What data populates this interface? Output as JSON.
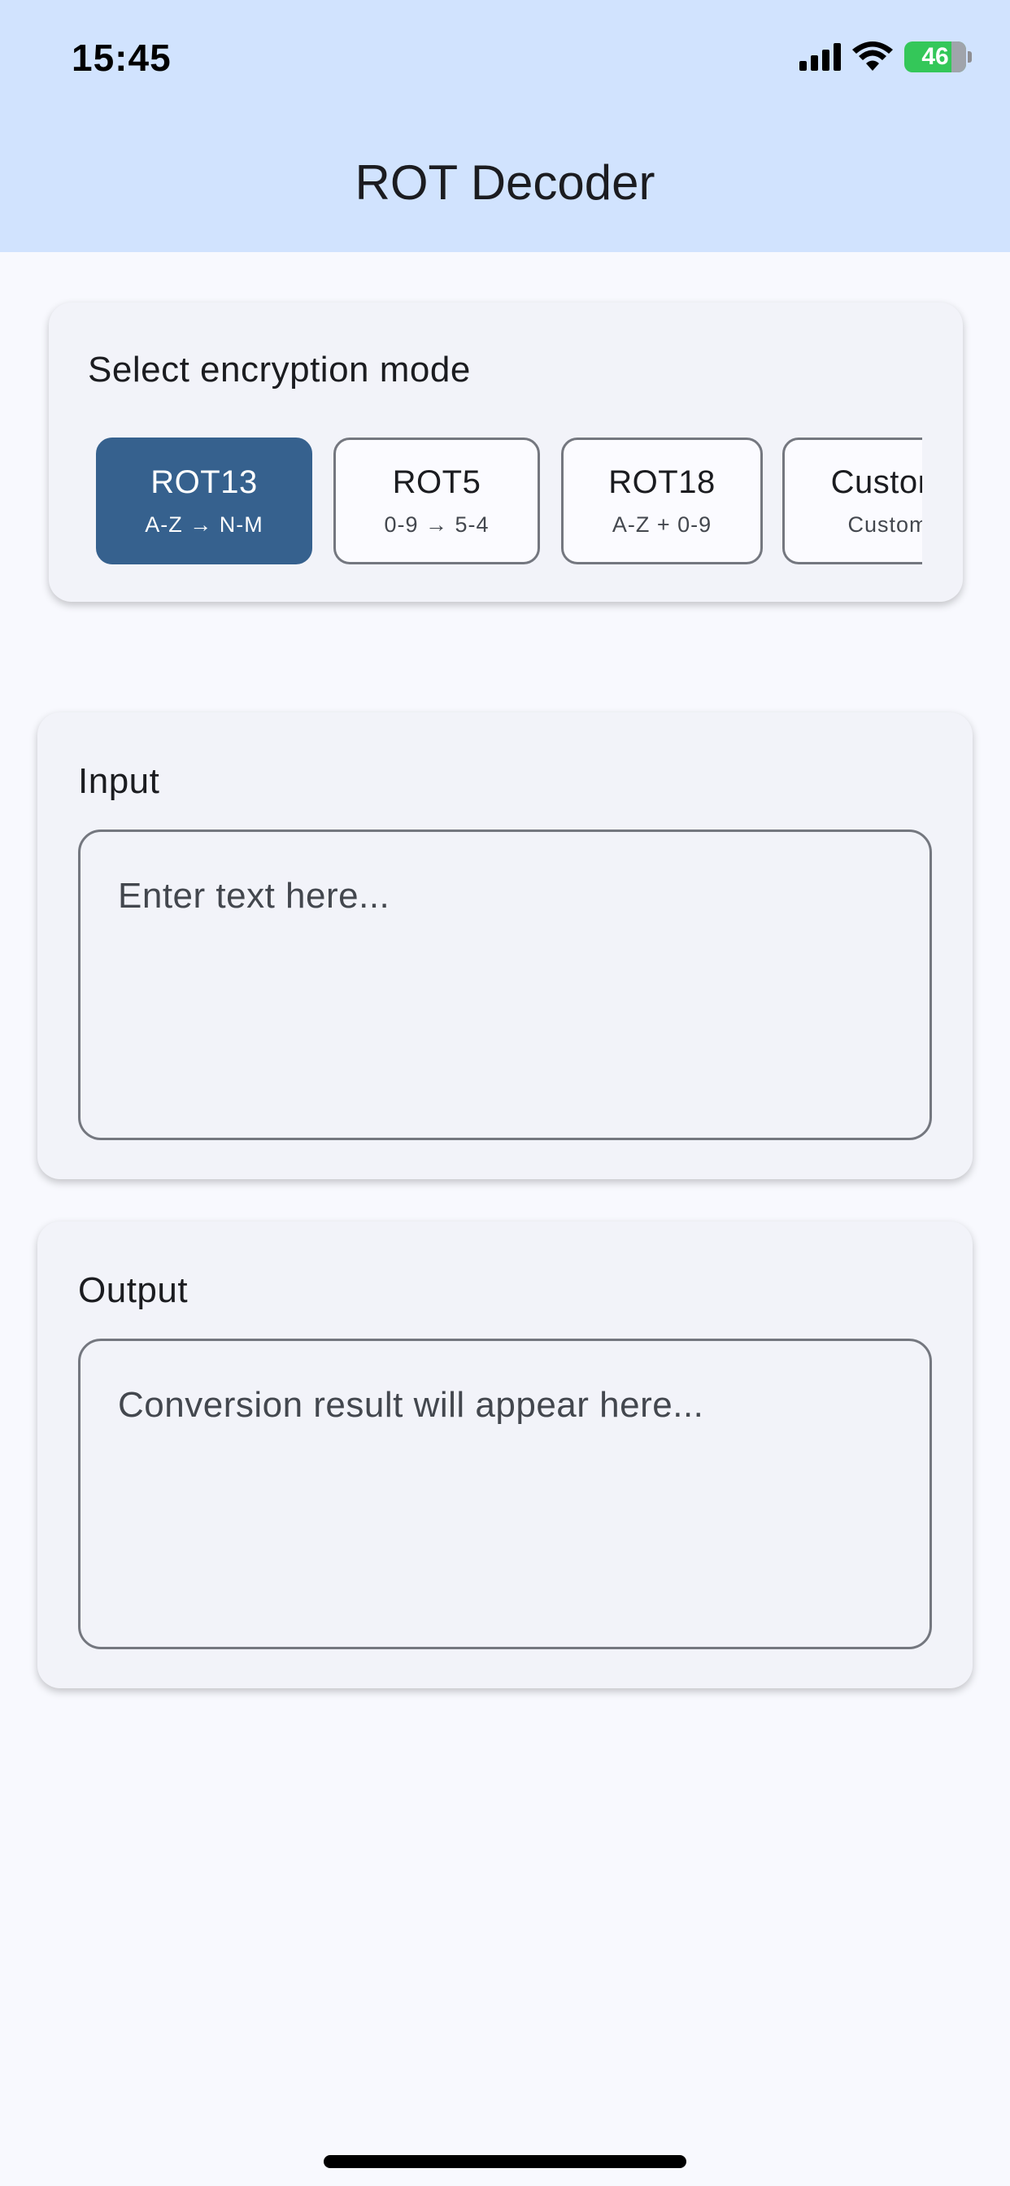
{
  "status_bar": {
    "time": "15:45",
    "battery": "46",
    "icons": [
      "signal-icon",
      "wifi-icon",
      "battery-icon"
    ]
  },
  "app_bar": {
    "title": "ROT Decoder"
  },
  "mode_selector": {
    "title": "Select encryption mode",
    "selected": "ROT13",
    "modes": [
      {
        "name": "ROT13",
        "desc": "A-Z → N-M"
      },
      {
        "name": "ROT5",
        "desc": "0-9 → 5-4"
      },
      {
        "name": "ROT18",
        "desc": "A-Z + 0-9"
      },
      {
        "name": "Custom",
        "desc": "Custom"
      }
    ]
  },
  "input": {
    "title": "Input",
    "placeholder": "Enter text here..."
  },
  "output": {
    "title": "Output",
    "placeholder": "Conversion result will appear here..."
  },
  "colors": {
    "app_bar": "#d1e3fe",
    "background": "#f8f9fe",
    "card": "#f2f3f9",
    "primary": "#36618e",
    "outline": "#74777f"
  }
}
